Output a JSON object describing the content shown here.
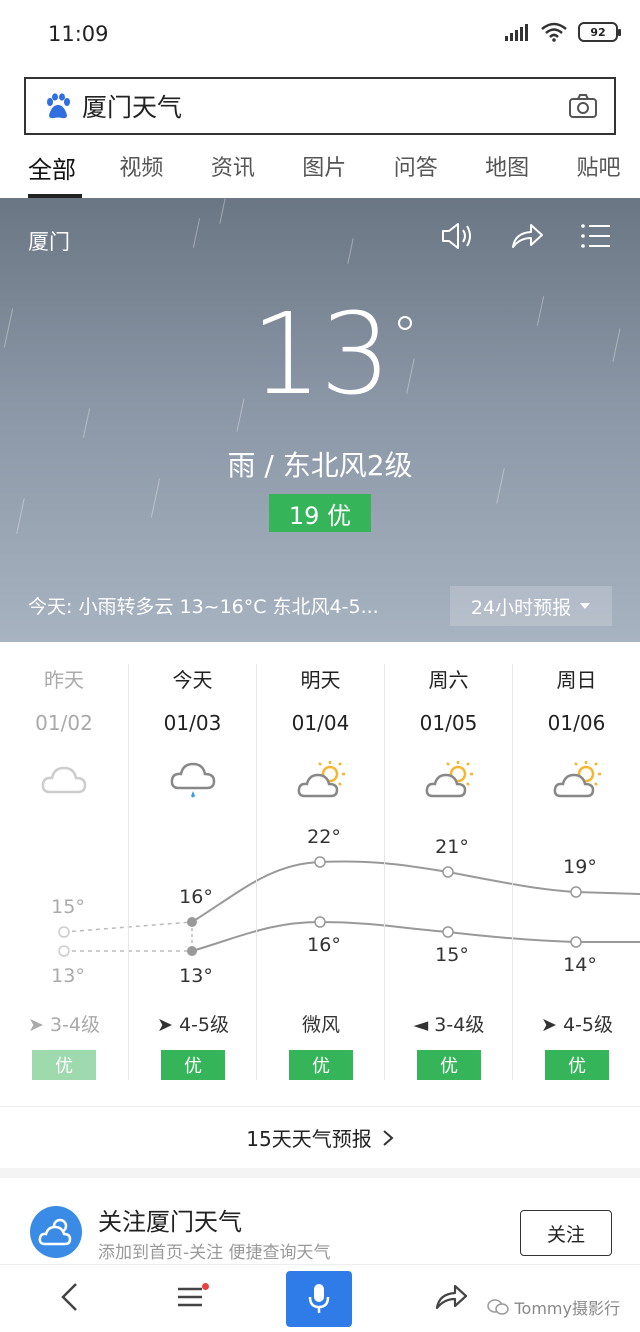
{
  "status_bar": {
    "time": "11:09",
    "battery": "92"
  },
  "search": {
    "query": "厦门天气"
  },
  "tabs": [
    {
      "label": "全部",
      "active": true
    },
    {
      "label": "视频"
    },
    {
      "label": "资讯"
    },
    {
      "label": "图片"
    },
    {
      "label": "问答"
    },
    {
      "label": "地图"
    },
    {
      "label": "贴吧"
    }
  ],
  "weather": {
    "city": "厦门",
    "temperature": "13",
    "condition": "雨 / 东北风2级",
    "aqi": "19 优",
    "today_summary": "今天:  小雨转多云   13~16°C   东北风4-5...",
    "hourly_button": "24小时预报"
  },
  "forecast": [
    {
      "day": "昨天",
      "date": "01/02",
      "high": "15°",
      "low": "13°",
      "wind": "3-4级",
      "aq": "优",
      "icon": "cloud-icon",
      "past": true
    },
    {
      "day": "今天",
      "date": "01/03",
      "high": "16°",
      "low": "13°",
      "wind": "4-5级",
      "aq": "优",
      "icon": "rain-cloud-icon"
    },
    {
      "day": "明天",
      "date": "01/04",
      "high": "22°",
      "low": "16°",
      "wind": "微风",
      "aq": "优",
      "icon": "sun-cloud-icon"
    },
    {
      "day": "周六",
      "date": "01/05",
      "high": "21°",
      "low": "15°",
      "wind": "3-4级",
      "aq": "优",
      "icon": "sun-cloud-icon"
    },
    {
      "day": "周日",
      "date": "01/06",
      "high": "19°",
      "low": "14°",
      "wind": "4-5级",
      "aq": "优",
      "icon": "sun-cloud-icon"
    }
  ],
  "more_link": "15天天气预报",
  "follow": {
    "title": "关注厦门天气",
    "subtitle": "添加到首页-关注 便捷查询天气",
    "button": "关注"
  },
  "watermark": "Tommy摄影行"
}
